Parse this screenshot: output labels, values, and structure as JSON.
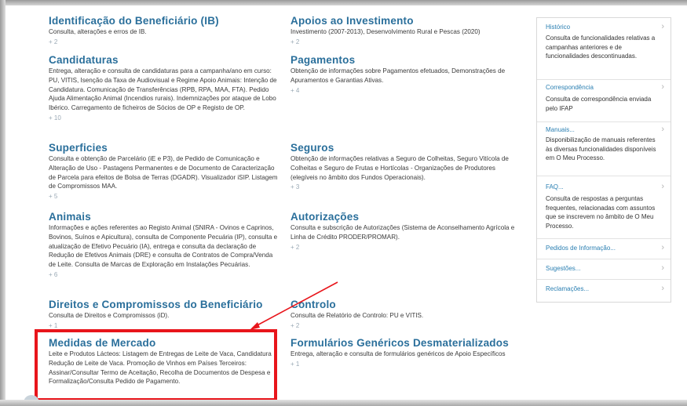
{
  "main": {
    "left_column": [
      {
        "title": "Identificação do Beneficiário (IB)",
        "text": "Consulta, alterações e erros de IB.",
        "more": "+ 2"
      },
      {
        "title": "Candidaturas",
        "text": "Entrega, alteração e consulta de candidaturas para a campanha/ano em curso: PU, VITIS, Isenção da Taxa de Audiovisual e Regime Apoio Animais: Intenção de Candidatura. Comunicação de Transferências (RPB, RPA, MAA, FTA). Pedido Ajuda Alimentação Animal (Incendios rurais). Indemnizações por ataque de Lobo Ibérico. Carregamento de ficheiros de Sócios de OP e Registo de OP.",
        "more": "+ 10"
      },
      {
        "title": "Superficies",
        "text": "Consulta e obtenção de Parcelário (iE e P3), de Pedido de Comunicação e Alteração de Uso - Pastagens Permanentes e de Documento de Caracterização de Parcela para efeitos de Bolsa de Terras (DGADR). Visualizador iSIP. Listagem de Compromissos MAA.",
        "more": "+ 5"
      },
      {
        "title": "Animais",
        "text": "Informações e ações referentes ao Registo Animal (SNIRA - Ovinos e Caprinos, Bovinos, Suínos e Apicultura), consulta de Componente Pecuária (IP), consulta e atualização de Efetivo Pecuário (IA), entrega e consulta da declaração de Redução de Efetivos Animais (DRE) e consulta de Contratos de Compra/Venda de Leite. Consulta de Marcas de Exploração em Instalações Pecuárias.",
        "more": "+ 6"
      },
      {
        "title": "Direitos e Compromissos do Beneficiário",
        "text": "Consulta de Direitos e Compromissos (iD).",
        "more": "+ 1"
      },
      {
        "title": "Medidas de Mercado",
        "text": "Leite e Produtos Lácteos: Listagem de Entregas de Leite de Vaca, Candidatura Redução de Leite de Vaca. Promoção de Vinhos em Países Terceiros: Assinar/Consultar Termo de Aceitação, Recolha de Documentos de Despesa e Formalização/Consulta Pedido de Pagamento.",
        "more": ""
      }
    ],
    "right_column": [
      {
        "title": "Apoios ao Investimento",
        "text": "Investimento (2007-2013), Desenvolvimento Rural e Pescas (2020)",
        "more": "+ 2"
      },
      {
        "title": "Pagamentos",
        "text": "Obtenção de informações sobre Pagamentos efetuados, Demonstrações de Apuramentos e Garantias Ativas.",
        "more": "+ 4"
      },
      {
        "title": "Seguros",
        "text": "Obtenção de informações relativas a Seguro de Colheitas, Seguro Vitícola de Colheitas e Seguro de Frutas e Hortícolas - Organizações de Produtores (elegíveis no âmbito dos Fundos Operacionais).",
        "more": "+ 3"
      },
      {
        "title": "Autorizações",
        "text": "Consulta e subscrição de Autorizações (Sistema de Aconselhamento Agrícola e Linha de Crédito PRODER/PROMAR).",
        "more": "+ 2"
      },
      {
        "title": "Controlo",
        "text": "Consulta de Relatório de Controlo: PU e VITIS.",
        "more": "+ 2"
      },
      {
        "title": "Formulários Genéricos Desmaterializados",
        "text": "Entrega, alteração e consulta de formulários genéricos de Apoio Específicos",
        "more": "+ 1"
      }
    ]
  },
  "side": {
    "items": [
      {
        "title": "Histórico",
        "desc": "Consulta de funcionalidades relativas a campanhas anteriores e de funcionalidades descontinuadas."
      },
      {
        "title": "Correspondência",
        "desc": "Consulta de correspondência enviada pelo IFAP"
      },
      {
        "title": "Manuais...",
        "desc": "Disponibilização de manuais referentes às diversas funcionalidades disponíveis em O Meu Processo."
      },
      {
        "title": "FAQ...",
        "desc": "Consulta de respostas a perguntas frequentes, relacionadas com assuntos que se inscrevem no âmbito de O Meu Processo."
      },
      {
        "title": "Pedidos de Informação...",
        "desc": ""
      },
      {
        "title": "Sugestões...",
        "desc": ""
      },
      {
        "title": "Reclamações...",
        "desc": ""
      }
    ],
    "chevron": "›"
  },
  "colors": {
    "title": "#2a6f9b",
    "link": "#2a7fb2",
    "highlight": "#e8151b"
  }
}
